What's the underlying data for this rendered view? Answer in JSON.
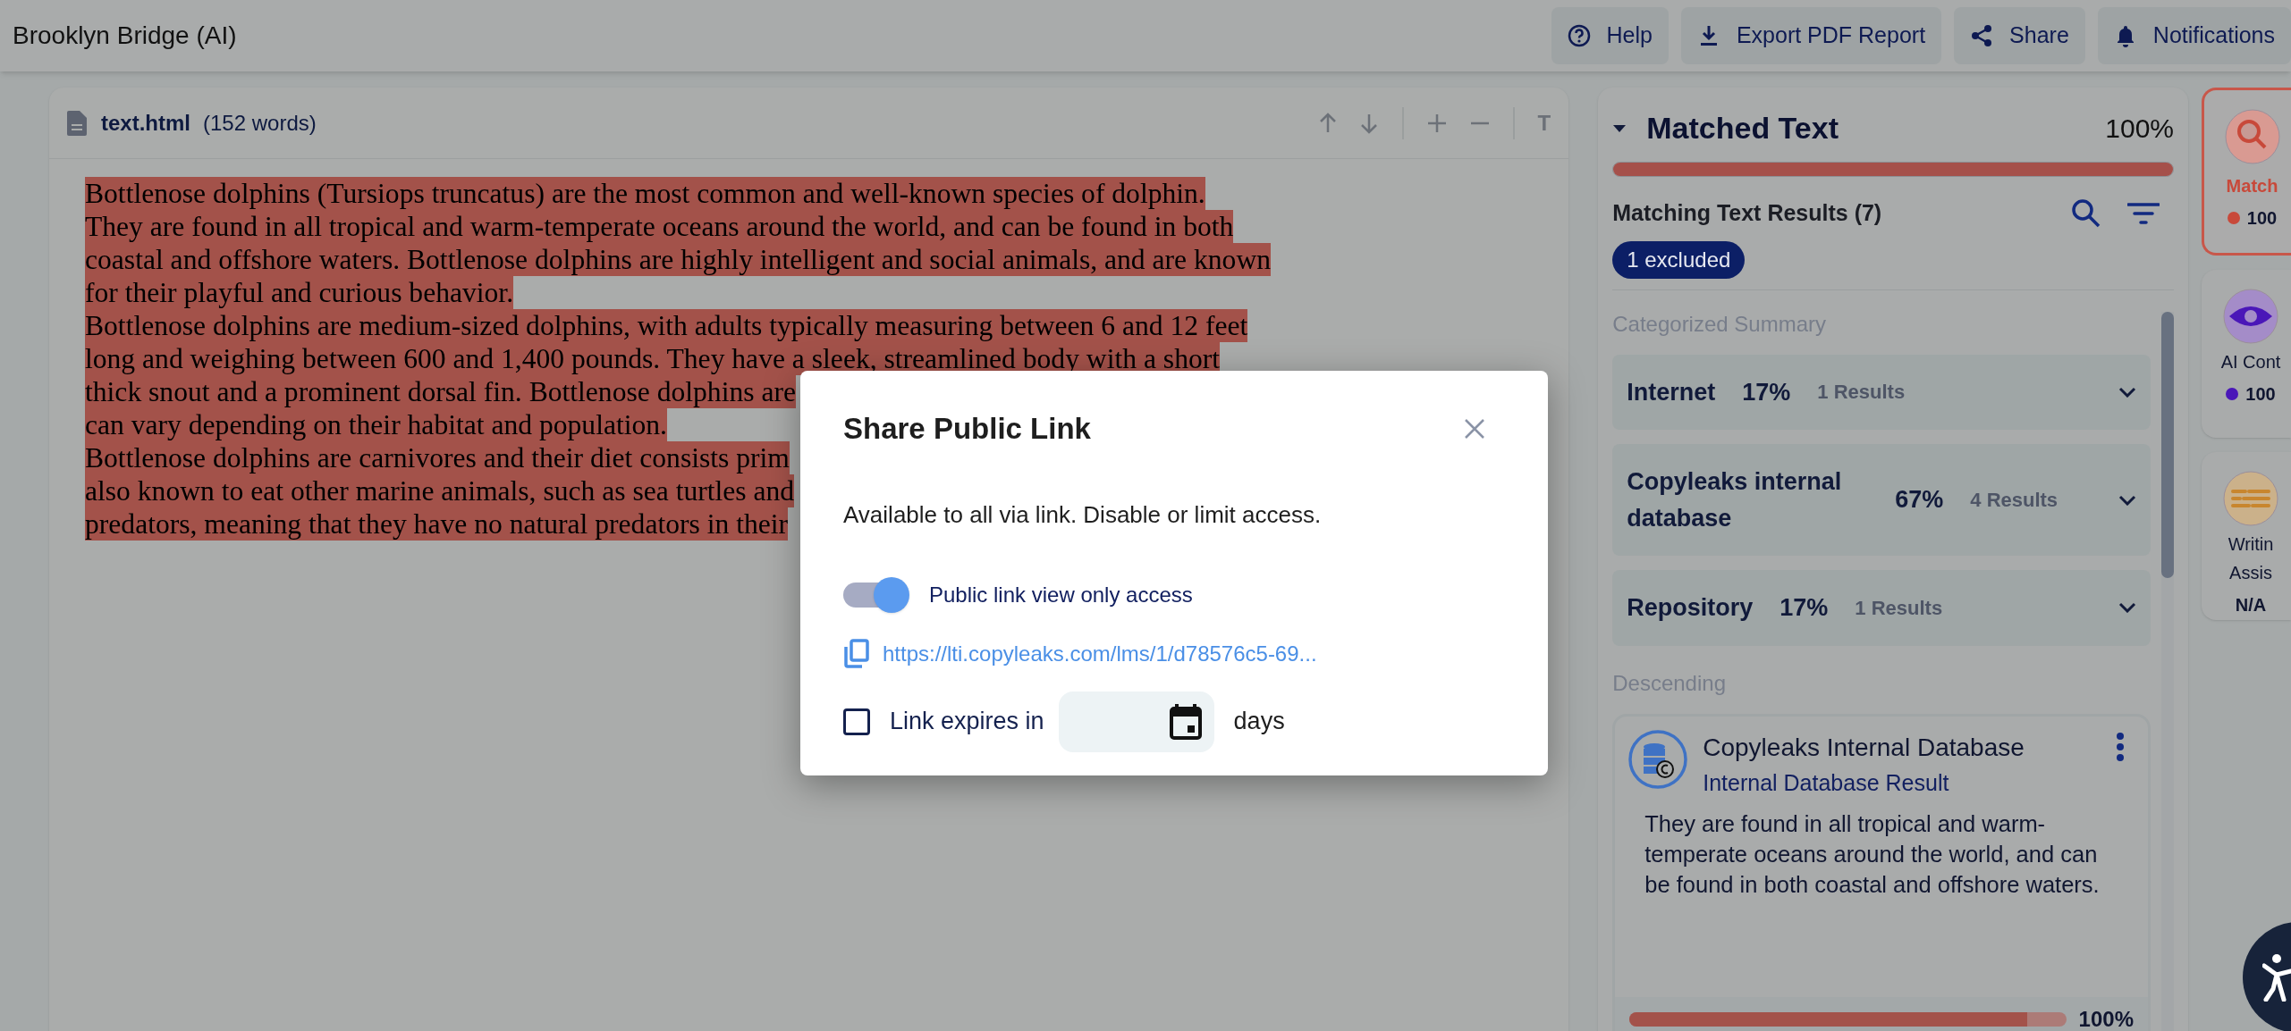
{
  "app_bar": {
    "title": "Brooklyn Bridge (AI)",
    "buttons": [
      {
        "kind": "help",
        "label": "Help"
      },
      {
        "kind": "download",
        "label": "Export PDF Report"
      },
      {
        "kind": "share",
        "label": "Share"
      },
      {
        "kind": "bell",
        "label": "Notifications"
      }
    ]
  },
  "document": {
    "file_name": "text.html",
    "word_count": "(152 words)",
    "toolbar_text_button": "T",
    "lines": [
      {
        "text": "Bottlenose dolphins (Tursiops truncatus) are the most common and well-known species of dolphin.",
        "highlighted": true
      },
      {
        "text": "They are found in all tropical and warm-temperate oceans around the world, and can be found in both",
        "highlighted": true
      },
      {
        "text": "coastal and offshore waters. Bottlenose dolphins are highly intelligent and social animals, and are known",
        "highlighted": true
      },
      {
        "text": "for their playful and curious behavior.",
        "highlighted": true
      },
      {
        "text": "Bottlenose dolphins are medium-sized dolphins, with adults typically measuring between 6 and 12 feet",
        "highlighted": true
      },
      {
        "text": "long and weighing between 600 and 1,400 pounds. They have a sleek, streamlined body with a short",
        "highlighted": true
      },
      {
        "text": "thick snout and a prominent dorsal fin. Bottlenose dolphins are",
        "highlighted": true
      },
      {
        "text": "can vary depending on their habitat and population.",
        "highlighted": true
      },
      {
        "text": "Bottlenose dolphins are carnivores and their diet consists prim",
        "highlighted": true
      },
      {
        "text": "also known to eat other marine animals, such as sea turtles and",
        "highlighted": true
      },
      {
        "text": "predators, meaning that they have no natural predators in their",
        "highlighted": true
      }
    ]
  },
  "results_panel": {
    "title": "Matched Text",
    "percent": "100%",
    "level": 1,
    "results_heading": "Matching Text Results (7)",
    "excluded_badge": "1 excluded",
    "summary_heading": "Categorized Summary",
    "categories": [
      {
        "name": "Internet",
        "percent": "17%",
        "count": "1 Results"
      },
      {
        "name": "Copyleaks internal database",
        "percent": "67%",
        "count": "4 Results"
      },
      {
        "name": "Repository",
        "percent": "17%",
        "count": "1 Results"
      }
    ],
    "sort_label": "Descending",
    "results": [
      {
        "title": "Copyleaks Internal Database",
        "subtitle": "Internal Database Result",
        "excerpt": "They are found in all tropical and warm-temperate oceans around the world, and can be found in both coastal and offshore waters.",
        "level": 0.91,
        "percent": "100%"
      }
    ]
  },
  "side_tabs": [
    {
      "kind": "magnifier",
      "label_lines": [
        "Match"
      ],
      "value": "100",
      "color": "#c8493a",
      "selected": true
    },
    {
      "kind": "eye",
      "label_lines": [
        "AI Cont"
      ],
      "value": "100",
      "color": "#4a17b8",
      "selected": false
    },
    {
      "kind": "lines",
      "label_lines": [
        "Writin",
        "Assis"
      ],
      "value": "N/A",
      "selected": false
    }
  ],
  "dialog": {
    "title": "Share Public Link",
    "description": "Available to all via link. Disable or limit access.",
    "toggle": {
      "label": "Public link view only access",
      "on": true
    },
    "link": "https://lti.copyleaks.com/lms/1/d78576c5-69...",
    "expiry": {
      "checked": false,
      "label": "Link expires in",
      "unit": "days"
    }
  }
}
